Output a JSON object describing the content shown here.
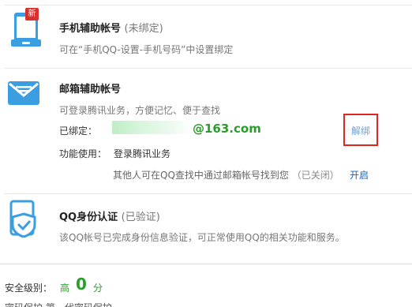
{
  "phone_section": {
    "badge": "新",
    "title": "手机辅助帐号",
    "status": "(未绑定)",
    "description": "可在“手机QQ-设置-手机号码”中设置绑定"
  },
  "email_section": {
    "title": "邮箱辅助帐号",
    "description": "可登录腾讯业务，方便记忆、便于查找",
    "bound_label": "已绑定：",
    "email_domain": "@163.com",
    "unbind_label": "解绑",
    "function_label": "功能使用：",
    "function_value": "登录腾讯业务",
    "search_note": "其他人可在QQ查找中通过邮箱帐号找到您",
    "search_status": "（已关闭）",
    "enable_label": "开启"
  },
  "identity_section": {
    "title": "QQ身份认证",
    "status": "(已验证)",
    "description": "该QQ帐号已完成身份信息验证，可正常使用QQ的相关功能和服务。"
  },
  "security": {
    "label": "安全级别：",
    "level": "高",
    "score": "0",
    "unit": "分",
    "cutoff_text": "密码保护    第一代密码保护"
  },
  "colors": {
    "accent_blue": "#3a9ee0",
    "success_green": "#2a9d2a",
    "highlight_red": "#e0261d",
    "link_blue": "#1a64b8"
  }
}
